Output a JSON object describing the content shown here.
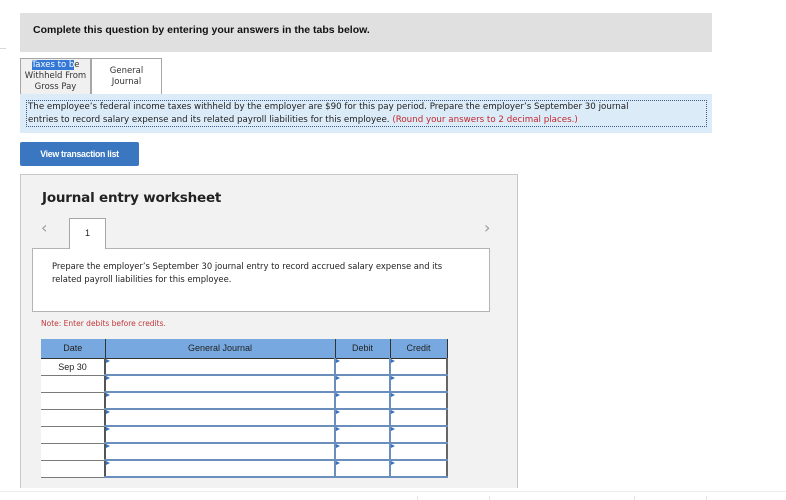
{
  "instruction": "Complete this question by entering your answers in the tabs below.",
  "tabs": [
    {
      "label_selected": "Taxes to b",
      "label_rest_line1": "e",
      "label_line2": "Withheld From",
      "label_line3": "Gross Pay",
      "active": false
    },
    {
      "label_line1": "General",
      "label_line2": "Journal",
      "active": true
    }
  ],
  "info": {
    "line1": "The employee’s federal income taxes withheld by the employer are $90 for this pay period. Prepare the employer’s September 30 journal",
    "line2_prefix": "entries to record salary expense and its related payroll liabilities for this employee. ",
    "line2_note": "(Round your answers to 2 decimal places.)"
  },
  "buttons": {
    "view_transaction_list": "View transaction list"
  },
  "worksheet": {
    "title": "Journal entry worksheet",
    "prev_icon": "‹",
    "next_icon": "›",
    "current_page": "1",
    "prompt": "Prepare the employer’s September 30 journal entry to record accrued salary expense and its related payroll liabilities for this employee.",
    "note": "Note: Enter debits before credits.",
    "columns": [
      "Date",
      "General Journal",
      "Debit",
      "Credit"
    ],
    "rows": [
      {
        "date": "Sep 30",
        "account": "",
        "debit": "",
        "credit": ""
      },
      {
        "date": "",
        "account": "",
        "debit": "",
        "credit": ""
      },
      {
        "date": "",
        "account": "",
        "debit": "",
        "credit": ""
      },
      {
        "date": "",
        "account": "",
        "debit": "",
        "credit": ""
      },
      {
        "date": "",
        "account": "",
        "debit": "",
        "credit": ""
      },
      {
        "date": "",
        "account": "",
        "debit": "",
        "credit": ""
      },
      {
        "date": "",
        "account": "",
        "debit": "",
        "credit": ""
      }
    ]
  },
  "colors": {
    "accent_button": "#3a77c0",
    "table_header": "#77a9e0",
    "info_background": "#dcebf8",
    "note_red": "#c0393b"
  }
}
